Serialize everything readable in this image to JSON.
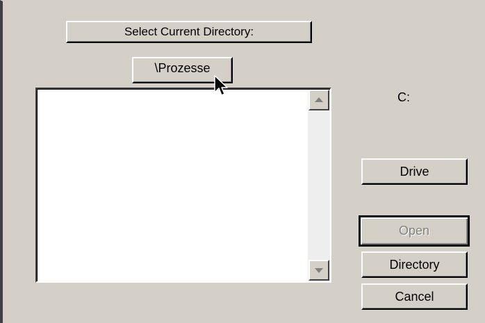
{
  "dialog": {
    "select_header": "Select Current Directory:",
    "current_directory": "\\Prozesse",
    "current_drive": "C:",
    "directory_list": {
      "items": []
    },
    "buttons": {
      "drive": "Drive",
      "open": "Open",
      "directory": "Directory",
      "cancel": "Cancel"
    },
    "open_enabled": false
  },
  "icons": {
    "scroll_up": "scroll-up-arrow",
    "scroll_down": "scroll-down-arrow",
    "cursor": "mouse-pointer"
  }
}
